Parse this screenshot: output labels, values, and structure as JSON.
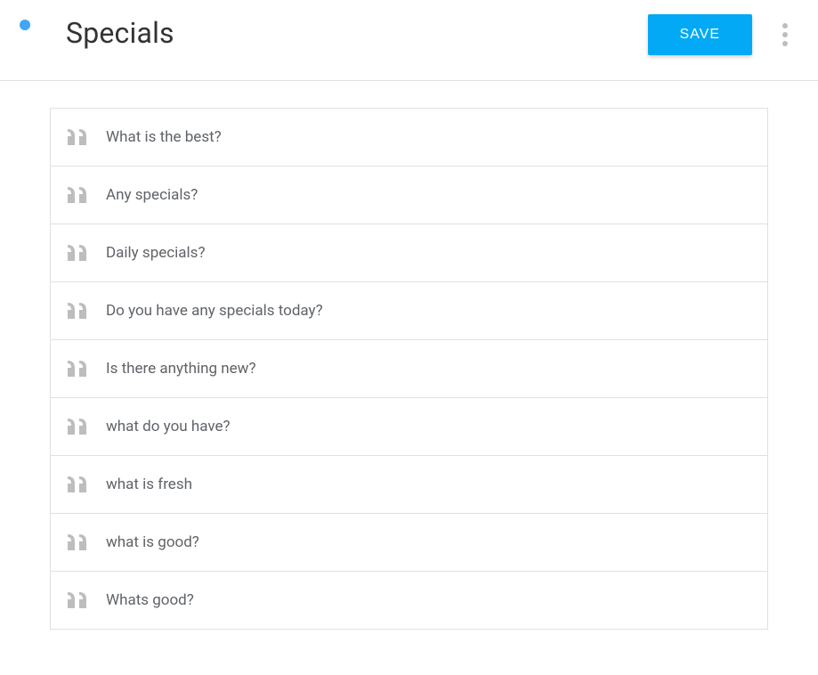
{
  "header": {
    "title": "Specials",
    "save_label": "SAVE"
  },
  "phrases": [
    {
      "text": "What is the best?"
    },
    {
      "text": "Any specials?"
    },
    {
      "text": "Daily specials?"
    },
    {
      "text": "Do you have any specials today?"
    },
    {
      "text": "Is there anything new?"
    },
    {
      "text": "what do you have?"
    },
    {
      "text": "what is fresh"
    },
    {
      "text": "what is good?"
    },
    {
      "text": "Whats good?"
    }
  ]
}
